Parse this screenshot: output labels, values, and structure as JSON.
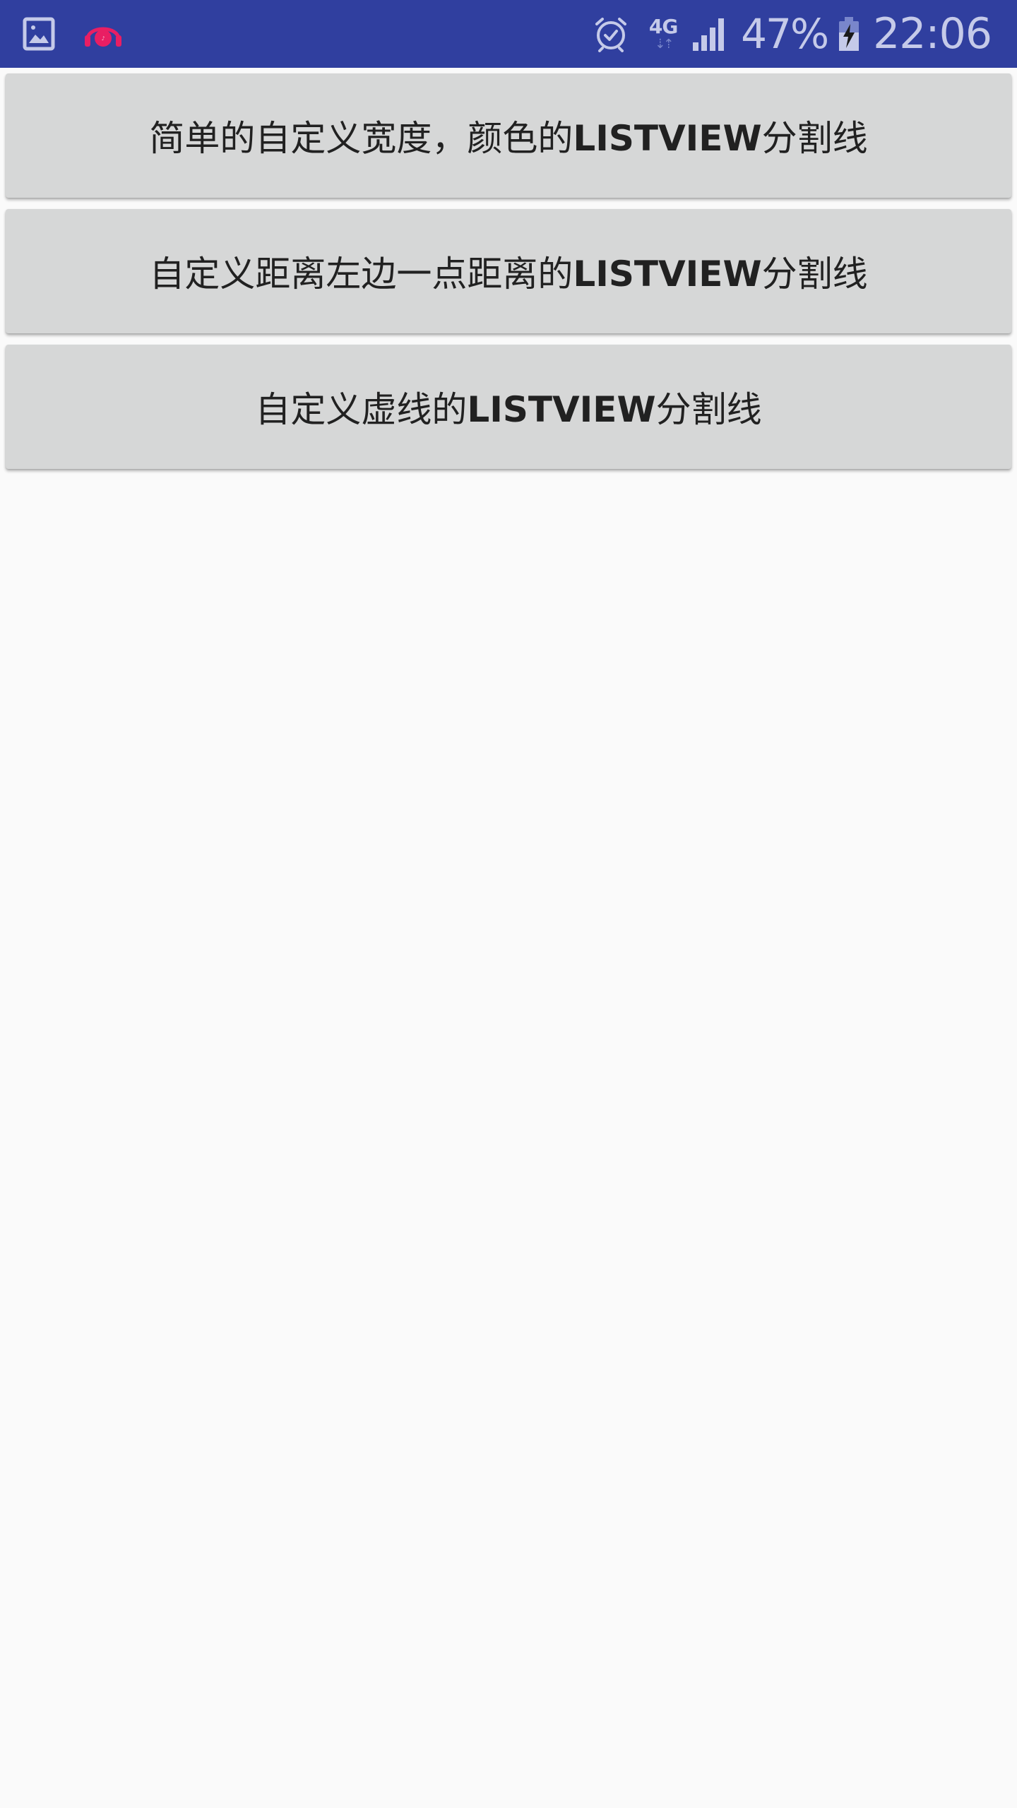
{
  "status_bar": {
    "left_icons": [
      "image-icon",
      "music-headphones-icon"
    ],
    "network_label": "4G",
    "battery_percent": "47%",
    "time": "22:06",
    "colors": {
      "background": "#303f9f",
      "foreground": "#c5cae9",
      "notification_music": "#e91e63"
    }
  },
  "buttons": [
    {
      "label_prefix": "简单的自定义宽度，颜色的",
      "label_strong": "LISTVIEW",
      "label_suffix": "分割线"
    },
    {
      "label_prefix": "自定义距离左边一点距离的",
      "label_strong": "LISTVIEW",
      "label_suffix": "分割线"
    },
    {
      "label_prefix": "自定义虚线的",
      "label_strong": "LISTVIEW",
      "label_suffix": "分割线"
    }
  ],
  "colors": {
    "page_background": "#fafafa",
    "button_background": "#d6d7d7",
    "button_text": "#212121"
  }
}
